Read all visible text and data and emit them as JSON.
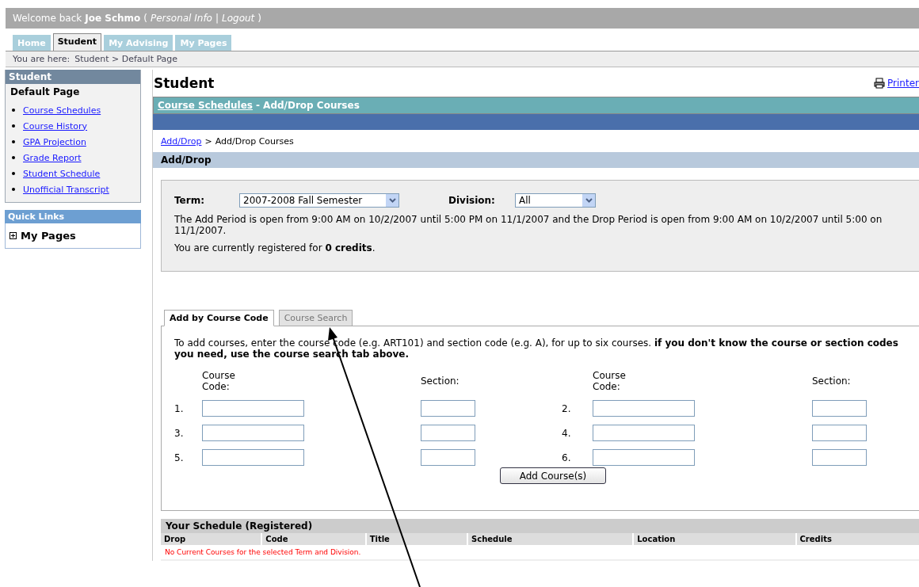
{
  "header": {
    "welcome": "Welcome back",
    "user": "Joe Schmo",
    "open": "(",
    "links": [
      "Personal Info",
      "Logout"
    ],
    "separator": "|",
    "close": ")"
  },
  "nav_tabs": [
    {
      "label": "Home",
      "selected": false
    },
    {
      "label": "Student",
      "selected": true
    },
    {
      "label": "My Advising",
      "selected": false
    },
    {
      "label": "My Pages",
      "selected": false
    }
  ],
  "breadcrumb": {
    "prefix": "You are here:",
    "path": "Student > Default Page"
  },
  "sidebar": {
    "title": "Student",
    "current": "Default Page",
    "links": [
      "Course Schedules",
      "Course History",
      "GPA Projection",
      "Grade Report",
      "Student Schedule",
      "Unofficial Transcript"
    ]
  },
  "quick_links": {
    "title": "Quick Links",
    "items": [
      {
        "label": "My Pages",
        "expanded": false
      }
    ]
  },
  "page_title": "Student",
  "printer_link": "Printer",
  "section_header": {
    "link": "Course Schedules",
    "rest": "- Add/Drop Courses"
  },
  "crumb": {
    "link": "Add/Drop",
    "separator": ">",
    "current": "Add/Drop Courses"
  },
  "subheader": "Add/Drop",
  "filters": [
    {
      "label": "Term:",
      "value": "2007-2008 Fall Semester"
    },
    {
      "label": "Division:",
      "value": "All"
    }
  ],
  "period_text": "The Add Period is open from 9:00 AM on 10/2/2007 until 5:00 PM on 11/1/2007 and the Drop Period is open from 9:00 AM on 10/2/2007 until 5:00 on 11/1/2007.",
  "credits_text": "You are currently registered for **0 credits**.",
  "course_tabs": [
    {
      "label": "Add by Course Code",
      "selected": true
    },
    {
      "label": "Course Search",
      "selected": false
    }
  ],
  "instructions": "To add courses, enter the course code (e.g. ART101) and section code (e.g. A), for up to six courses. **if you don't know the course or section codes you need, use the course search tab above.**",
  "entry_columns": [
    {
      "course_label": "Course Code:",
      "section_label": "Section:",
      "rows": [
        "1.",
        "3.",
        "5."
      ]
    },
    {
      "course_label": "Course Code:",
      "section_label": "Section:",
      "rows": [
        "2.",
        "4.",
        "6."
      ]
    }
  ],
  "add_button": "Add Course(s)",
  "schedule": {
    "title": "Your Schedule (Registered)",
    "columns": [
      "Drop",
      "Code",
      "Title",
      "Schedule",
      "Location",
      "Credits"
    ],
    "empty_message": "No Current Courses for the selected Term and Division."
  }
}
